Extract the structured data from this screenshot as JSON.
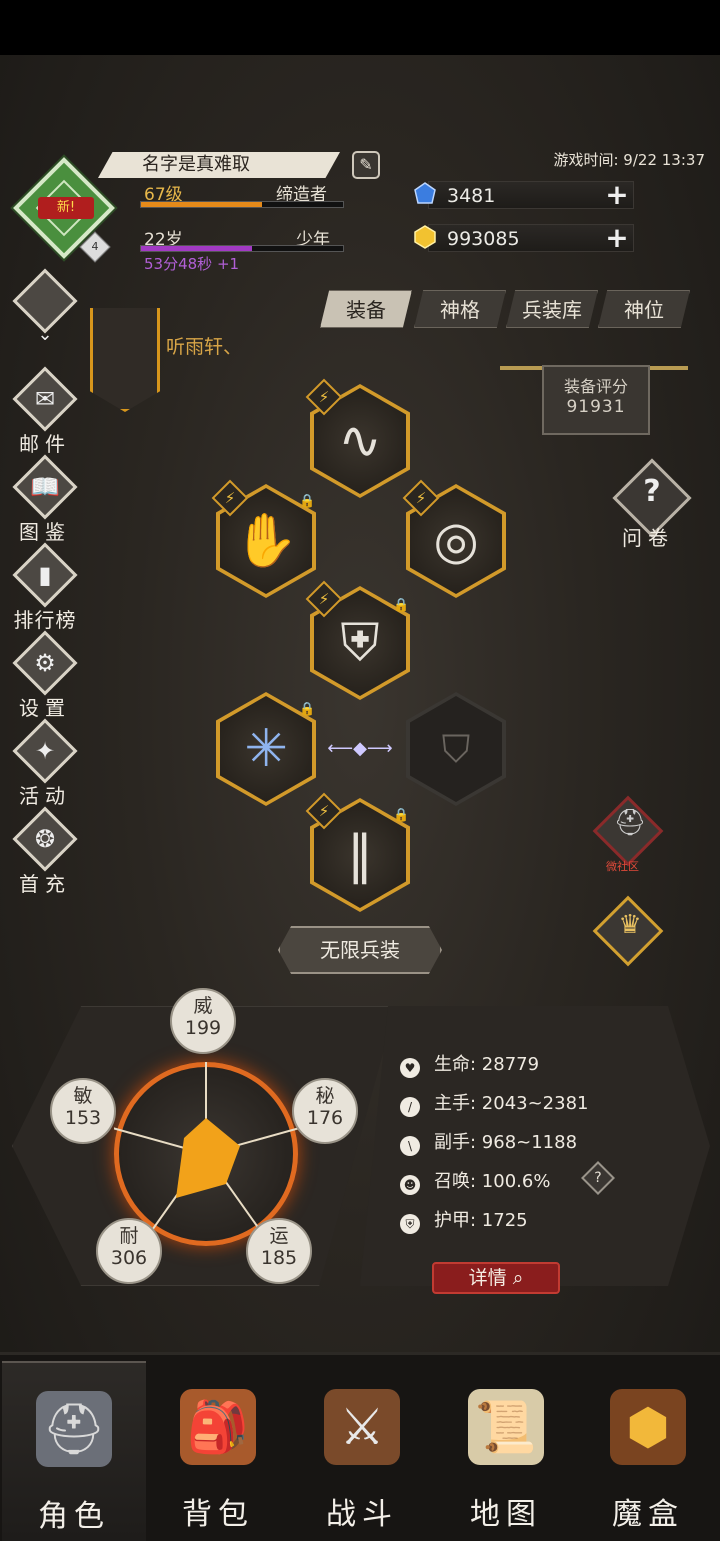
{
  "header": {
    "name": "名字是真难取",
    "level": "67级",
    "title": "缔造者",
    "age": "22岁",
    "age_stage": "少年",
    "timer": "53分48秒 +1",
    "new_badge": "新!",
    "avatar_level": "4",
    "game_time": "游戏时间: 9/22 13:37",
    "level_progress": 0.6,
    "age_progress": 0.55
  },
  "currency": {
    "gems": "3481",
    "gold": "993085"
  },
  "side_menu": [
    {
      "label": "",
      "icon": "menu-icon"
    },
    {
      "label": "邮件",
      "icon": "mail-icon"
    },
    {
      "label": "图鉴",
      "icon": "book-icon"
    },
    {
      "label": "排行榜",
      "icon": "ranking-icon"
    },
    {
      "label": "设置",
      "icon": "gear-icon"
    },
    {
      "label": "活动",
      "icon": "event-icon"
    },
    {
      "label": "首充",
      "icon": "first-recharge-icon"
    }
  ],
  "tabs": [
    "装备",
    "神格",
    "兵装库",
    "神位"
  ],
  "guild_name": "听雨轩、",
  "score": {
    "label": "装备评分",
    "value": "91931"
  },
  "survey_label": "问卷",
  "community_label": "微社区",
  "infinite_button": "无限兵装",
  "stats": {
    "wei": {
      "name": "威",
      "value": "199"
    },
    "mi": {
      "name": "秘",
      "value": "176"
    },
    "yun": {
      "name": "运",
      "value": "185"
    },
    "nai": {
      "name": "耐",
      "value": "306"
    },
    "min": {
      "name": "敏",
      "value": "153"
    }
  },
  "attributes": [
    {
      "label": "生命: 28779",
      "icon": "heart-icon"
    },
    {
      "label": "主手: 2043~2381",
      "icon": "sword-icon"
    },
    {
      "label": "副手: 968~1188",
      "icon": "offhand-icon"
    },
    {
      "label": "召唤: 100.6%",
      "icon": "summon-icon"
    },
    {
      "label": "护甲: 1725",
      "icon": "armor-icon"
    }
  ],
  "detail_button": "详情",
  "nav": [
    {
      "label": "角色",
      "icon": "helmet-icon",
      "active": true
    },
    {
      "label": "背包",
      "icon": "backpack-icon"
    },
    {
      "label": "战斗",
      "icon": "battle-icon"
    },
    {
      "label": "地图",
      "icon": "map-icon"
    },
    {
      "label": "魔盒",
      "icon": "magic-box-icon"
    }
  ],
  "colors": {
    "accent_gold": "#d29a2a",
    "gem_blue": "#3b7de0",
    "gold_yellow": "#f2c230",
    "level_bar": "#e58a1a",
    "age_bar": "#a23ac4",
    "detail_red": "#8a1d1d"
  }
}
